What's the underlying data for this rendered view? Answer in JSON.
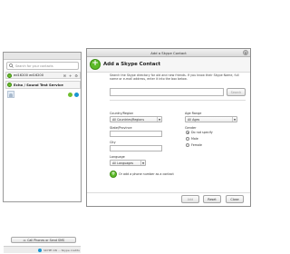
{
  "main_window": {
    "search_placeholder": "Search for your contacts",
    "username": "ed16200 ed16200",
    "contact_group": "Echo / Sound Test Service",
    "call_button": "Call Phones or Send SMS",
    "status_text": "SKYPE ON ... Skype credits",
    "toolbar_icons": [
      "mail-icon",
      "add-contact-icon",
      "gear-icon"
    ]
  },
  "dialog": {
    "window_title": "Add a Skype Contact",
    "heading": "Add a Skype Contact",
    "intro_text": "Search the Skype directory for old and new friends. If you know their Skype Name, full name or e-mail address, enter it into the box below.",
    "search_button": "Search",
    "country_label": "Country/Region",
    "country_value": "All Countries/Regions",
    "age_label": "Age Range",
    "age_value": "All Ages",
    "state_label": "State/Province",
    "gender_label": "Gender",
    "gender_options": [
      "Do not specify",
      "Male",
      "Female"
    ],
    "gender_selected": 0,
    "city_label": "City",
    "language_label": "Language",
    "language_value": "All Languages",
    "phone_link": "Or add a phone number as a contact",
    "add_button": "Add",
    "reset_button": "Reset",
    "close_button": "Close"
  },
  "colors": {
    "online_green": "#6fbe2e",
    "skype_blue": "#1996d2"
  }
}
